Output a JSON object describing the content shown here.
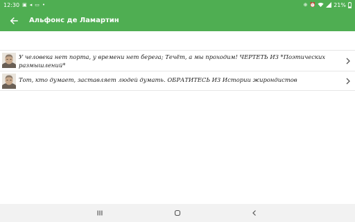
{
  "status_bar": {
    "time": "12:30",
    "battery": "21%",
    "left_icons": [
      "image-icon",
      "send-icon",
      "cast-icon",
      "dot-icon"
    ],
    "right_icons": [
      "battery-saver-icon",
      "alarm-icon",
      "wifi-icon",
      "signal-icon",
      "battery-icon"
    ]
  },
  "app_bar": {
    "title": "Альфонс де Ламартин",
    "color": "#4fae52"
  },
  "quotes": [
    {
      "text": "У человека нет порта, у времени нет берега; Течёт, а мы проходим! ЧЕРТЕТЬ ИЗ *Поэтических размышлений*"
    },
    {
      "text": "Тот, кто думает, заставляет людей думать. ОБРАТИТЕСЬ ИЗ Истории жирондистов"
    }
  ],
  "nav_bar": {
    "buttons": [
      "recents-icon",
      "home-icon",
      "back-icon"
    ]
  }
}
